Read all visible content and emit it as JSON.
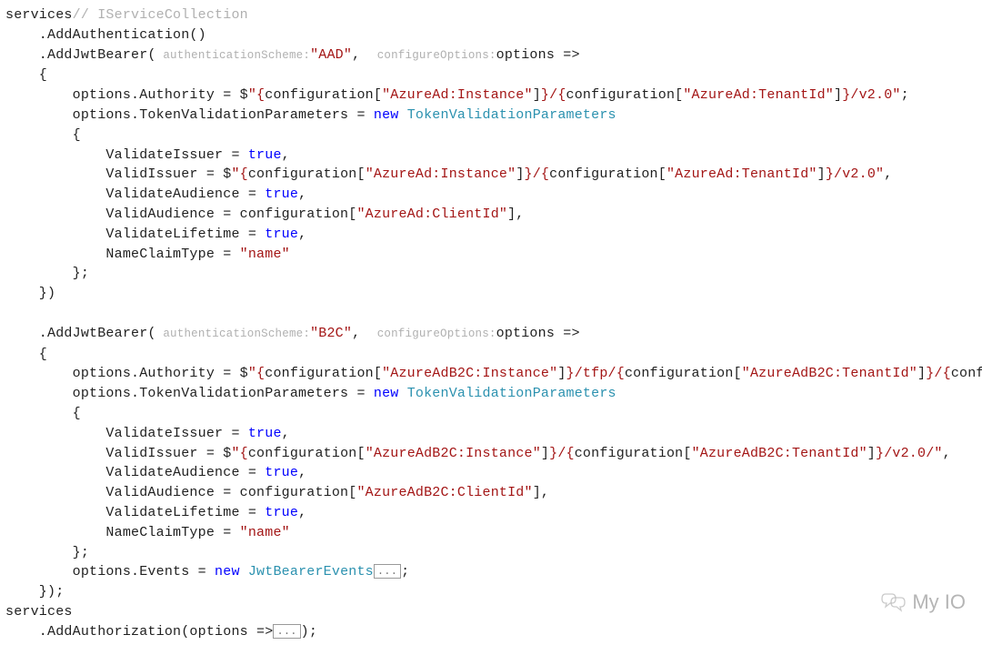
{
  "code": {
    "l01_a": "services",
    "l01_comment": "// IServiceCollection",
    "l02": "    .AddAuthentication()",
    "l03_a": "    .AddJwtBearer(",
    "l03_hint1": " authenticationScheme:",
    "l03_str": "\"AAD\"",
    "l03_b": ",  ",
    "l03_hint2": "configureOptions:",
    "l03_c": "options =>",
    "l04": "    {",
    "l05_a": "        options.Authority = $",
    "l05_str1": "\"{",
    "l05_b": "configuration[",
    "l05_str2": "\"AzureAd:Instance\"",
    "l05_c": "]",
    "l05_str3": "}/{",
    "l05_d": "configuration[",
    "l05_str4": "\"AzureAd:TenantId\"",
    "l05_e": "]",
    "l05_str5": "}/v2.0\"",
    "l05_f": ";",
    "l06_a": "        options.TokenValidationParameters = ",
    "l06_kw": "new",
    "l06_sp": " ",
    "l06_type": "TokenValidationParameters",
    "l07": "        {",
    "l08_a": "            ValidateIssuer = ",
    "l08_kw": "true",
    "l08_b": ",",
    "l09_a": "            ValidIssuer = $",
    "l09_str1": "\"{",
    "l09_b": "configuration[",
    "l09_str2": "\"AzureAd:Instance\"",
    "l09_c": "]",
    "l09_str3": "}/{",
    "l09_d": "configuration[",
    "l09_str4": "\"AzureAd:TenantId\"",
    "l09_e": "]",
    "l09_str5": "}/v2.0\"",
    "l09_f": ",",
    "l10_a": "            ValidateAudience = ",
    "l10_kw": "true",
    "l10_b": ",",
    "l11_a": "            ValidAudience = configuration[",
    "l11_str": "\"AzureAd:ClientId\"",
    "l11_b": "],",
    "l12_a": "            ValidateLifetime = ",
    "l12_kw": "true",
    "l12_b": ",",
    "l13_a": "            NameClaimType = ",
    "l13_str": "\"name\"",
    "l14": "        };",
    "l15": "    })",
    "blank": "",
    "l17_a": "    .AddJwtBearer(",
    "l17_hint1": " authenticationScheme:",
    "l17_str": "\"B2C\"",
    "l17_b": ",  ",
    "l17_hint2": "configureOptions:",
    "l17_c": "options =>",
    "l18": "    {",
    "l19_a": "        options.Authority = $",
    "l19_str1": "\"{",
    "l19_b": "configuration[",
    "l19_str2": "\"AzureAdB2C:Instance\"",
    "l19_c": "]",
    "l19_str3": "}/tfp/{",
    "l19_d": "configuration[",
    "l19_str4": "\"AzureAdB2C:TenantId\"",
    "l19_e": "]",
    "l19_str5": "}/{",
    "l19_f": "conf",
    "l20_a": "        options.TokenValidationParameters = ",
    "l20_kw": "new",
    "l20_sp": " ",
    "l20_type": "TokenValidationParameters",
    "l21": "        {",
    "l22_a": "            ValidateIssuer = ",
    "l22_kw": "true",
    "l22_b": ",",
    "l23_a": "            ValidIssuer = $",
    "l23_str1": "\"{",
    "l23_b": "configuration[",
    "l23_str2": "\"AzureAdB2C:Instance\"",
    "l23_c": "]",
    "l23_str3": "}/{",
    "l23_d": "configuration[",
    "l23_str4": "\"AzureAdB2C:TenantId\"",
    "l23_e": "]",
    "l23_str5": "}/v2.0/\"",
    "l23_f": ",",
    "l24_a": "            ValidateAudience = ",
    "l24_kw": "true",
    "l24_b": ",",
    "l25_a": "            ValidAudience = configuration[",
    "l25_str": "\"AzureAdB2C:ClientId\"",
    "l25_b": "],",
    "l26_a": "            ValidateLifetime = ",
    "l26_kw": "true",
    "l26_b": ",",
    "l27_a": "            NameClaimType = ",
    "l27_str": "\"name\"",
    "l28": "        };",
    "l29_a": "        options.Events = ",
    "l29_kw": "new",
    "l29_sp": " ",
    "l29_type": "JwtBearerEvents",
    "l29_fold": "...",
    "l29_b": ";",
    "l30": "    });",
    "l31": "services",
    "l32_a": "    .AddAuthorization(options =>",
    "l32_fold": "...",
    "l32_b": ");"
  },
  "watermark": "My IO"
}
